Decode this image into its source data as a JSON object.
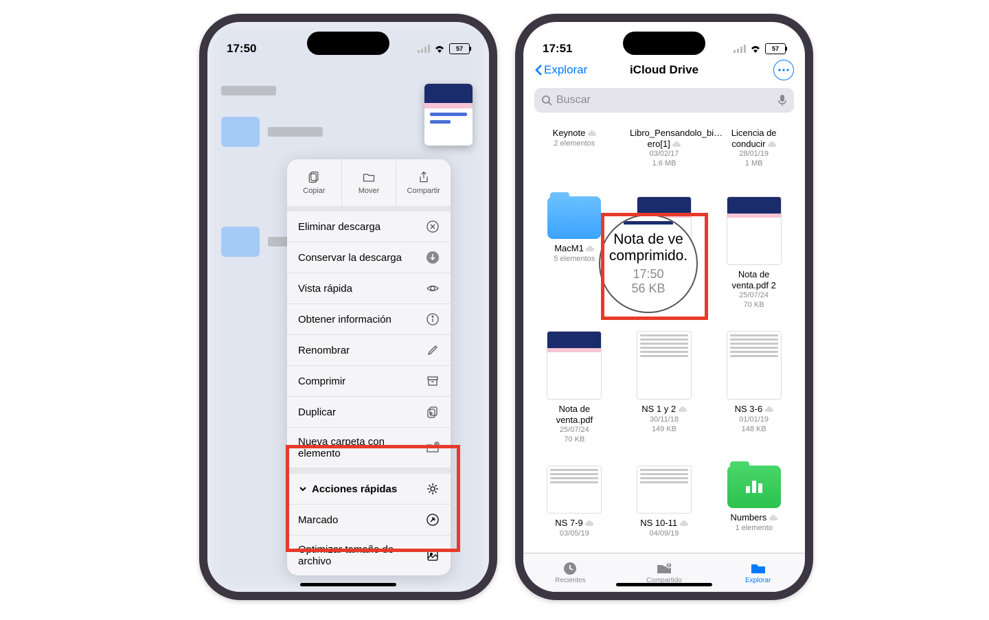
{
  "phone_left": {
    "status_time": "17:50",
    "battery": "57",
    "menu_top": {
      "copy": "Copiar",
      "move": "Mover",
      "share": "Compartir"
    },
    "menu_rows": {
      "remove_download": "Eliminar descarga",
      "keep_download": "Conservar la descarga",
      "quick_look": "Vista rápida",
      "get_info": "Obtener información",
      "rename": "Renombrar",
      "compress": "Comprimir",
      "duplicate": "Duplicar",
      "new_folder": "Nueva carpeta con elemento"
    },
    "quick_actions": {
      "header": "Acciones rápidas",
      "markup": "Marcado",
      "optimize": "Optimizar tamaño de archivo"
    }
  },
  "phone_right": {
    "status_time": "17:51",
    "battery": "57",
    "nav": {
      "back": "Explorar",
      "title": "iCloud Drive"
    },
    "search_placeholder": "Buscar",
    "files": {
      "r0c0": {
        "name": "Keynote",
        "meta1": "2 elementos"
      },
      "r0c1": {
        "name": "Libro_Pensandolo_bi…ero[1]",
        "meta1": "03/02/17",
        "meta2": "1.6 MB"
      },
      "r0c2": {
        "name": "Licencia de conducir",
        "meta1": "28/01/19",
        "meta2": "1 MB"
      },
      "r1c0": {
        "name": "MacM1",
        "meta1": "5 elementos"
      },
      "r1c2": {
        "name": "Nota de venta.pdf 2",
        "meta1": "25/07/24",
        "meta2": "70 KB"
      },
      "r2c0": {
        "name": "Nota de venta.pdf",
        "meta1": "25/07/24",
        "meta2": "70 KB"
      },
      "r2c1": {
        "name": "NS 1 y 2",
        "meta1": "30/11/18",
        "meta2": "149 KB"
      },
      "r2c2": {
        "name": "NS 3-6",
        "meta1": "01/01/19",
        "meta2": "148 KB"
      },
      "r3c0": {
        "name": "NS 7-9",
        "meta1": "03/05/19"
      },
      "r3c1": {
        "name": "NS 10-11",
        "meta1": "04/09/19"
      },
      "r3c2": {
        "name": "Numbers",
        "meta1": "1 elemento"
      }
    },
    "mag": {
      "l1": "Nota de ve",
      "l2": "comprimido.",
      "time": "17:50",
      "size": "56 KB"
    },
    "tabs": {
      "recent": "Recientes",
      "shared": "Compartido",
      "browse": "Explorar"
    }
  }
}
